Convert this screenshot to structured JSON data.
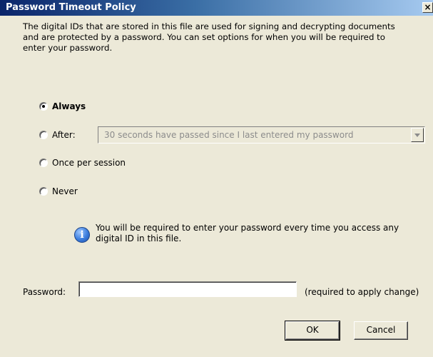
{
  "window": {
    "title": "Password Timeout Policy",
    "close_label": "×"
  },
  "description": "The digital IDs that are stored in this file are used for signing and decrypting documents\nand are protected by a password. You can set options for when you will be required to\nenter your password.",
  "options": {
    "always": {
      "label": "Always",
      "checked": true
    },
    "after": {
      "label": "After:",
      "checked": false
    },
    "once": {
      "label": "Once per session",
      "checked": false
    },
    "never": {
      "label": "Never",
      "checked": false
    }
  },
  "after_select": {
    "value": "30 seconds have passed since I last entered my password"
  },
  "info": {
    "icon": "info-icon",
    "text": "You will be required to enter your password every time you access any digital ID in this file."
  },
  "password": {
    "label": "Password:",
    "value": "",
    "hint": "(required to apply change)"
  },
  "buttons": {
    "ok": "OK",
    "cancel": "Cancel"
  }
}
